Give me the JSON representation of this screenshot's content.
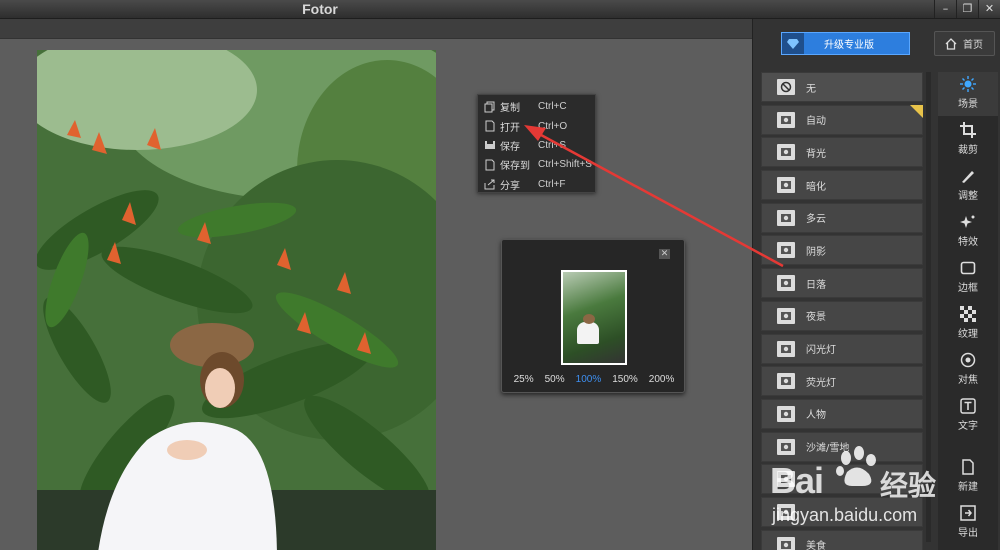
{
  "window": {
    "title": "Fotor",
    "controls": [
      "–",
      "❐",
      "✕"
    ]
  },
  "context_menu": {
    "items": [
      {
        "label": "复制",
        "shortcut": "Ctrl+C",
        "icon": "copy-icon"
      },
      {
        "label": "打开",
        "shortcut": "Ctrl+O",
        "icon": "open-file-icon"
      },
      {
        "label": "保存",
        "shortcut": "Ctrl+S",
        "icon": "save-icon"
      },
      {
        "label": "保存到",
        "shortcut": "Ctrl+Shift+S",
        "icon": "save-as-icon"
      },
      {
        "label": "分享",
        "shortcut": "Ctrl+F",
        "icon": "share-icon"
      }
    ]
  },
  "navigator": {
    "zoom_options": [
      "25%",
      "50%",
      "100%",
      "150%",
      "200%"
    ],
    "active_zoom": "100%"
  },
  "header": {
    "upgrade_label": "升级专业版",
    "home_label": "首页"
  },
  "scenes": [
    {
      "label": "无",
      "icon": "none-icon"
    },
    {
      "label": "自动",
      "icon": "camera-icon"
    },
    {
      "label": "背光",
      "icon": "backlight-icon"
    },
    {
      "label": "暗化",
      "icon": "darken-icon"
    },
    {
      "label": "多云",
      "icon": "cloudy-icon"
    },
    {
      "label": "阴影",
      "icon": "shadow-icon"
    },
    {
      "label": "日落",
      "icon": "sunset-icon"
    },
    {
      "label": "夜景",
      "icon": "night-icon"
    },
    {
      "label": "闪光灯",
      "icon": "flash-icon"
    },
    {
      "label": "荧光灯",
      "icon": "fluorescent-icon"
    },
    {
      "label": "人物",
      "icon": "portrait-icon"
    },
    {
      "label": "沙滩/雪地",
      "icon": "beach-icon"
    },
    {
      "label": "",
      "icon": "landscape-icon"
    },
    {
      "label": "",
      "icon": "flower-icon"
    },
    {
      "label": "美食",
      "icon": "food-icon"
    }
  ],
  "tools": [
    {
      "label": "场景",
      "icon": "scene-icon"
    },
    {
      "label": "裁剪",
      "icon": "crop-icon"
    },
    {
      "label": "调整",
      "icon": "adjust-icon"
    },
    {
      "label": "特效",
      "icon": "effects-icon"
    },
    {
      "label": "边框",
      "icon": "border-icon"
    },
    {
      "label": "纹理",
      "icon": "texture-icon"
    },
    {
      "label": "对焦",
      "icon": "focus-icon"
    },
    {
      "label": "文字",
      "icon": "text-icon"
    },
    {
      "label": "新建",
      "icon": "new-icon"
    },
    {
      "label": "导出",
      "icon": "export-icon"
    }
  ],
  "watermark": {
    "brand": "Bai",
    "brand_suffix": "经验",
    "url": "jingyan.baidu.com"
  },
  "colors": {
    "accent": "#2d7ede",
    "arrow": "#e53935",
    "active_zoom": "#3e8ff0"
  }
}
